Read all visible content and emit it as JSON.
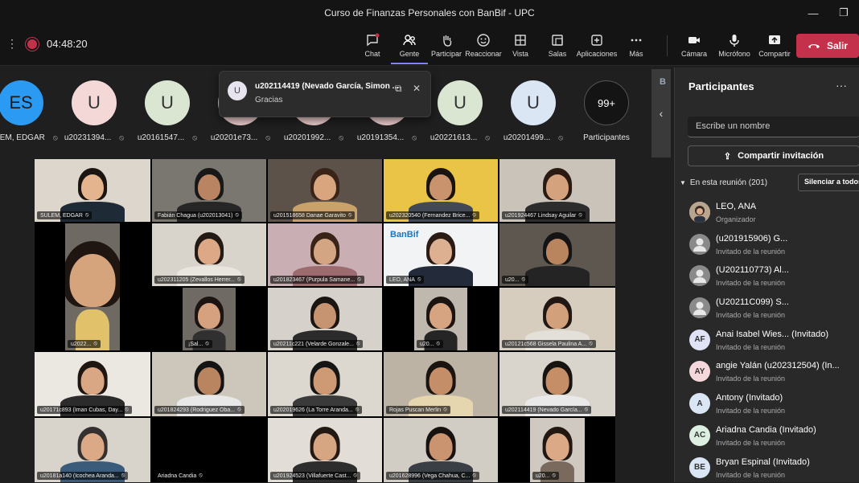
{
  "window": {
    "title": "Curso de Finanzas Personales con BanBif - UPC"
  },
  "recording": {
    "time": "04:48:20"
  },
  "toolbar": {
    "items": [
      {
        "label": "Chat",
        "icon": "chat-icon"
      },
      {
        "label": "Gente",
        "icon": "people-icon"
      },
      {
        "label": "Participar",
        "icon": "raise-hand-icon"
      },
      {
        "label": "Reaccionar",
        "icon": "reaction-icon"
      },
      {
        "label": "Vista",
        "icon": "view-grid-icon"
      },
      {
        "label": "Salas",
        "icon": "breakout-rooms-icon"
      },
      {
        "label": "Aplicaciones",
        "icon": "apps-icon"
      },
      {
        "label": "Más",
        "icon": "more-icon"
      }
    ],
    "right": [
      {
        "label": "Cámara",
        "icon": "camera-icon"
      },
      {
        "label": "Micrófono",
        "icon": "microphone-icon"
      },
      {
        "label": "Compartir",
        "icon": "share-screen-icon"
      }
    ],
    "leave": "Salir"
  },
  "strip": {
    "avatars": [
      {
        "initials": "ES",
        "name": "SULEM, EDGAR",
        "color": "#2b9af3"
      },
      {
        "initials": "U",
        "name": "u20231394...",
        "color": "#f4d8d8"
      },
      {
        "initials": "U",
        "name": "u20161547...",
        "color": "#dbe6d2"
      },
      {
        "initials": "",
        "name": "u20201e73...",
        "color": "#e9c9c9"
      },
      {
        "initials": "",
        "name": "u20201992...",
        "color": "#e9c9c9"
      },
      {
        "initials": "",
        "name": "u20191354...",
        "color": "#e9c9c9"
      },
      {
        "initials": "U",
        "name": "u20221613...",
        "color": "#dbe6d2"
      },
      {
        "initials": "U",
        "name": "u20201499...",
        "color": "#dbe6f4"
      },
      {
        "initials": "99+",
        "name": "Participantes",
        "color": "#141414"
      }
    ]
  },
  "toast": {
    "avatar": "U",
    "name": "u202114419 (Nevado García, Simon ...",
    "message": "Gracias"
  },
  "grid": {
    "tiles": [
      {
        "label": "SULEM, EDGAR",
        "bg": "#dcd6cc",
        "skin": "#e3b48e",
        "hair": "#1c1410",
        "shirt": "#1e2a35"
      },
      {
        "label": "Fabián Chagua (u202013041)",
        "bg": "#7a7670",
        "skin": "#b98461",
        "hair": "#181818",
        "shirt": "#262626"
      },
      {
        "label": "u201518658 Danae Garavito",
        "bg": "#5d524a",
        "skin": "#d9a57f",
        "hair": "#3a2418",
        "shirt": "#c9a26a"
      },
      {
        "label": "u202320540 (Fernandez Brice...",
        "bg": "#e9c446",
        "skin": "#c9936e",
        "hair": "#1a1410",
        "shirt": "#444a55"
      },
      {
        "label": "u201924467 Lindsay Aguilar",
        "bg": "#c9c3b9",
        "skin": "#d4a27d",
        "hair": "#2a1a12",
        "shirt": "#2d2d2d"
      },
      {
        "label": "u2022...",
        "bg": "#6e6a63",
        "skin": "#d6a47c",
        "hair": "#1f1612",
        "shirt": "#e1c16a"
      },
      {
        "label": "u202311205 (Zevallos Herrer...",
        "bg": "#d8d3cb",
        "skin": "#dca885",
        "hair": "#231a15",
        "shirt": "#e9e6e0"
      },
      {
        "label": "u201823467 (Purpula Samane...",
        "bg": "#c9aeb3",
        "skin": "#d3a583",
        "hair": "#3a2418",
        "shirt": "#9c6b70"
      },
      {
        "label": "LEO, ANA",
        "bg": "#f2f3f5",
        "skin": "#ddb091",
        "hair": "#2a1b14",
        "shirt": "#232a3a"
      },
      {
        "label": "u20...",
        "bg": "#5e5750",
        "skin": "#b9855f",
        "hair": "#141414",
        "shirt": "#242424"
      },
      {
        "label": "¡Sal...",
        "bg": "#6f6a64",
        "skin": "#d5a17f",
        "hair": "#1d1411",
        "shirt": "#303030"
      },
      {
        "label": "u20211c221 (Velarde Gonzale...",
        "bg": "#d6d2cb",
        "skin": "#c69471",
        "hair": "#1b1512",
        "shirt": "#2b2b2b"
      },
      {
        "label": "u20...",
        "bg": "#bfb8ae",
        "skin": "#d6a480",
        "hair": "#1b1411",
        "shirt": "#252525"
      },
      {
        "label": "u20121c568 Gissela Paulina A...",
        "bg": "#d7cdbf",
        "skin": "#d2a07b",
        "hair": "#221712",
        "shirt": "#e3e0da"
      },
      {
        "label": "u20171c893 (Iman Cubas, Day...",
        "bg": "#ebe8e2",
        "skin": "#d9a784",
        "hair": "#1f1511",
        "shirt": "#2b2b2b"
      },
      {
        "label": "u201824293 (Rodriguez Oba...",
        "bg": "#ccc6bb",
        "skin": "#b98561",
        "hair": "#141414",
        "shirt": "#e8e8e8"
      },
      {
        "label": "u202019626 (La Torre Aranda...",
        "bg": "#dcd7cf",
        "skin": "#cd9a75",
        "hair": "#151515",
        "shirt": "#3a3a3a"
      },
      {
        "label": "Rojas Puscan Merlin",
        "bg": "#bdb3a4",
        "skin": "#c48e69",
        "hair": "#1a1410",
        "shirt": "#e6d6b0"
      },
      {
        "label": "u202114419 (Nevado García...",
        "bg": "#d9d4cc",
        "skin": "#c58e67",
        "hair": "#171310",
        "shirt": "#e9e9e9"
      },
      {
        "label": "u20181a140 (Icochea Aranda...",
        "bg": "#d8d4cc",
        "skin": "#dca986",
        "hair": "#343030",
        "shirt": "#3a5b7a"
      },
      {
        "label": "Ariadna Candia",
        "bg": "#000000",
        "skin": "",
        "hair": "",
        "shirt": ""
      },
      {
        "label": "u201924523 (Villafuerte Cast...",
        "bg": "#e2ddd6",
        "skin": "#d6a683",
        "hair": "#241812",
        "shirt": "#2d2d2d"
      },
      {
        "label": "u201628996 (Vega Chahua, C...",
        "bg": "#d1ccc4",
        "skin": "#c9946f",
        "hair": "#171210",
        "shirt": "#3a3f46"
      },
      {
        "label": "u20...",
        "bg": "#cfc9c1",
        "skin": "#dba986",
        "hair": "#231712",
        "shirt": "#7a6a5d"
      }
    ],
    "brand": "BanBif"
  },
  "panel": {
    "title": "Participantes",
    "search_placeholder": "Escribe un nombre",
    "share_label": "Compartir invitación",
    "section_label": "En esta reunión (201)",
    "mute_all": "Silenciar a todos",
    "people": [
      {
        "initials": "",
        "name": "LEO, ANA",
        "status": "Organizador",
        "color": "#c8b8a6",
        "photo": true
      },
      {
        "initials": "",
        "name": "(u201915906) G...",
        "status": "Invitado de la reunión",
        "color": "#8a8a8a",
        "photo": false
      },
      {
        "initials": "",
        "name": "(U202110773) Al...",
        "status": "Invitado de la reunión",
        "color": "#8a8a8a",
        "photo": false
      },
      {
        "initials": "",
        "name": "(U20211C099) S...",
        "status": "Invitado de la reunión",
        "color": "#8a8a8a",
        "photo": false
      },
      {
        "initials": "AF",
        "name": "Anai Isabel Wies...  (Invitado)",
        "status": "Invitado de la reunión",
        "color": "#dfe3f5",
        "photo": false
      },
      {
        "initials": "AY",
        "name": "angie Yalán (u202312504) (In...",
        "status": "Invitado de la reunión",
        "color": "#f4d8dc",
        "photo": false
      },
      {
        "initials": "A",
        "name": "Antony (Invitado)",
        "status": "Invitado de la reunión",
        "color": "#dbe6f4",
        "photo": false
      },
      {
        "initials": "AC",
        "name": "Ariadna Candia (Invitado)",
        "status": "Invitado de la reunión",
        "color": "#dcefe0",
        "photo": false
      },
      {
        "initials": "BE",
        "name": "Bryan Espinal (Invitado)",
        "status": "Invitado de la reunión",
        "color": "#dbe6f4",
        "photo": false
      }
    ]
  }
}
